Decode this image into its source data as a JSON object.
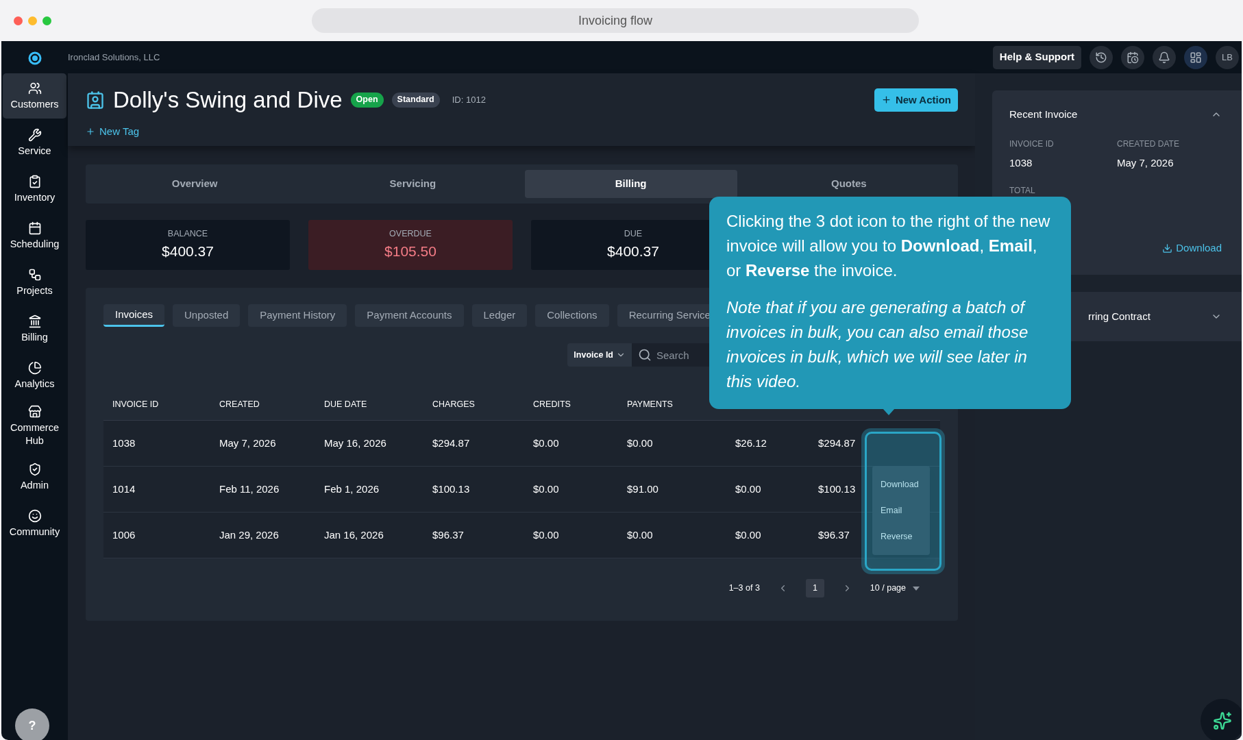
{
  "window": {
    "title": "Invoicing flow"
  },
  "topbar": {
    "company": "Ironclad Solutions, LLC",
    "help": "Help & Support",
    "avatar": "LB"
  },
  "sidebar": {
    "items": [
      {
        "label": "Customers",
        "selected": true
      },
      {
        "label": "Service",
        "selected": false
      },
      {
        "label": "Inventory",
        "selected": false
      },
      {
        "label": "Scheduling",
        "selected": false
      },
      {
        "label": "Projects",
        "selected": false
      },
      {
        "label": "Billing",
        "selected": false
      },
      {
        "label": "Analytics",
        "selected": false
      },
      {
        "label": "Commerce Hub",
        "selected": false
      },
      {
        "label": "Admin",
        "selected": false
      },
      {
        "label": "Community",
        "selected": false
      }
    ],
    "help": "?"
  },
  "header": {
    "title": "Dolly's Swing and Dive",
    "badges": [
      {
        "label": "Open",
        "color": "#16a34a"
      },
      {
        "label": "Standard",
        "color": "#3a4250"
      }
    ],
    "id": "ID: 1012",
    "new_tag": "New Tag",
    "new_action": "New Action"
  },
  "tabs": [
    {
      "label": "Overview",
      "selected": false
    },
    {
      "label": "Servicing",
      "selected": false
    },
    {
      "label": "Billing",
      "selected": true
    },
    {
      "label": "Quotes",
      "selected": false
    }
  ],
  "stats": [
    {
      "kind": "normal",
      "label": "BALANCE",
      "value": "$400.37"
    },
    {
      "kind": "overdue",
      "label": "OVERDUE",
      "value": "$105.50"
    },
    {
      "kind": "normal",
      "label": "DUE",
      "value": "$400.37"
    }
  ],
  "subtabs": [
    {
      "label": "Invoices",
      "selected": true
    },
    {
      "label": "Unposted",
      "selected": false
    },
    {
      "label": "Payment History",
      "selected": false
    },
    {
      "label": "Payment Accounts",
      "selected": false
    },
    {
      "label": "Ledger",
      "selected": false
    },
    {
      "label": "Collections",
      "selected": false
    },
    {
      "label": "Recurring Service",
      "selected": false
    }
  ],
  "search": {
    "filter": "Invoice Id",
    "placeholder": "Search"
  },
  "table": {
    "columns": [
      "INVOICE ID",
      "CREATED",
      "DUE DATE",
      "CHARGES",
      "CREDITS",
      "PAYMENTS"
    ],
    "rows": [
      [
        "1038",
        "May 7, 2026",
        "May 16, 2026",
        "$294.87",
        "$0.00",
        "$0.00",
        "$26.12",
        "$294.87"
      ],
      [
        "1014",
        "Feb 11, 2026",
        "Feb 1, 2026",
        "$100.13",
        "$0.00",
        "$91.00",
        "$0.00",
        "$100.13"
      ],
      [
        "1006",
        "Jan 29, 2026",
        "Jan 16, 2026",
        "$96.37",
        "$0.00",
        "$0.00",
        "$0.00",
        "$96.37"
      ]
    ],
    "menu": [
      "Download",
      "Email",
      "Reverse"
    ]
  },
  "pagination": {
    "range": "1–3 of 3",
    "pages": [
      {
        "label": "1",
        "selected": true
      }
    ],
    "page_size": "10 / page"
  },
  "right_panel": {
    "recent_invoice": {
      "title": "Recent Invoice",
      "fields": [
        {
          "label": "INVOICE ID",
          "value": "1038"
        },
        {
          "label": "CREATED DATE",
          "value": "May 7, 2026"
        }
      ],
      "total_label": "TOTAL",
      "download": "Download"
    },
    "contract": {
      "title": "rring Contract"
    }
  },
  "tooltip": {
    "paragraphs": [
      "Clicking the 3 dot icon to the right of the new invoice will allow you to **Download**, **Email**, or **Reverse** the invoice.",
      "Note that if you are generating a batch of invoices in bulk, you can also email those invoices in bulk, which we will see later in this video."
    ]
  }
}
